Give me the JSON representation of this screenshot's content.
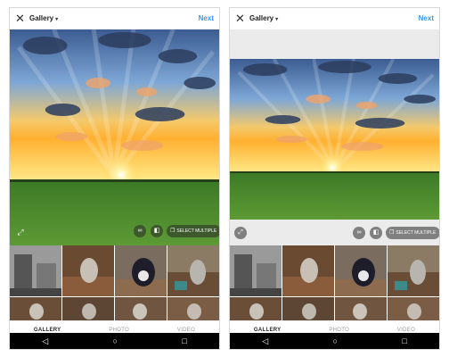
{
  "header": {
    "title": "Gallery",
    "caret": "▾",
    "next_label": "Next",
    "close_glyph": "✕"
  },
  "controls": {
    "expand_glyph": "⤢",
    "infinity_glyph": "∞",
    "layout_glyph": "◧",
    "select_multiple_glyph": "❐",
    "select_multiple_label": "SELECT MULTIPLE"
  },
  "tabs": [
    "GALLERY",
    "PHOTO",
    "VIDEO"
  ],
  "nav": {
    "back": "◁",
    "home": "○",
    "recents": "□"
  },
  "colors": {
    "accent": "#3897f0",
    "sky_top": "#3e5f93",
    "horizon": "#ffd24a",
    "grass": "#4f8a2d"
  }
}
